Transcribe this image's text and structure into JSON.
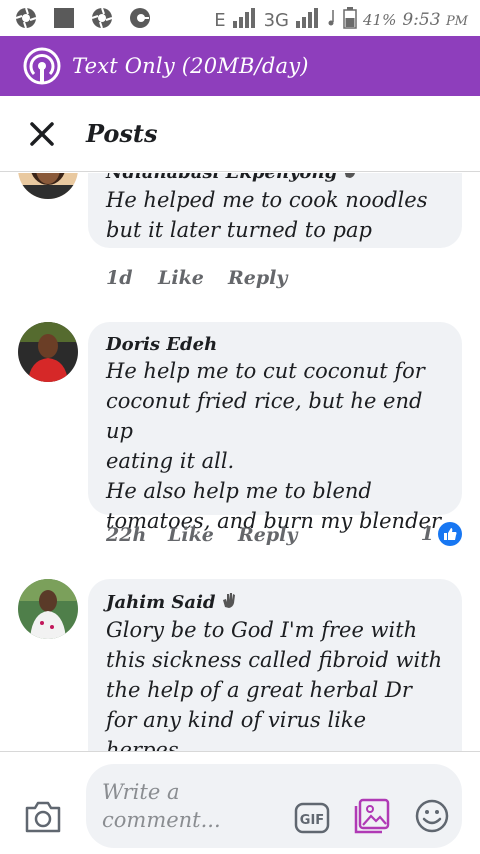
{
  "status_bar": {
    "network": "E",
    "network2": "3G",
    "battery_percent": "41%",
    "time": "9:53",
    "ampm": "PM"
  },
  "banner": {
    "text": "Text Only (20MB/day)"
  },
  "header": {
    "title": "Posts"
  },
  "comments": [
    {
      "author": "Ndianabasi Ekpenyong",
      "text": "He helped me to  cook noodles\nbut it later turned to pap",
      "time": "1d",
      "like": "Like",
      "reply": "Reply"
    },
    {
      "author": "Doris Edeh",
      "text": "He help me to cut coconut for\ncoconut fried rice, but he end up\neating it all.\nHe also help me to blend\ntomatoes, and burn my blender",
      "time": "22h",
      "like": "Like",
      "reply": "Reply",
      "reactions": "1"
    },
    {
      "author": "Jahim Said",
      "text": "Glory be to God I'm free with\nthis sickness called fibroid with\nthe help of a great herbal Dr\nfor any kind of virus like herpes\nHepatitis b or c"
    }
  ],
  "composer": {
    "placeholder": "Write a\ncomment..."
  },
  "colors": {
    "banner": "#8e3ebc",
    "bubble": "#f0f2f5",
    "like_badge": "#1877f2",
    "sticker": "#b03ab5"
  }
}
